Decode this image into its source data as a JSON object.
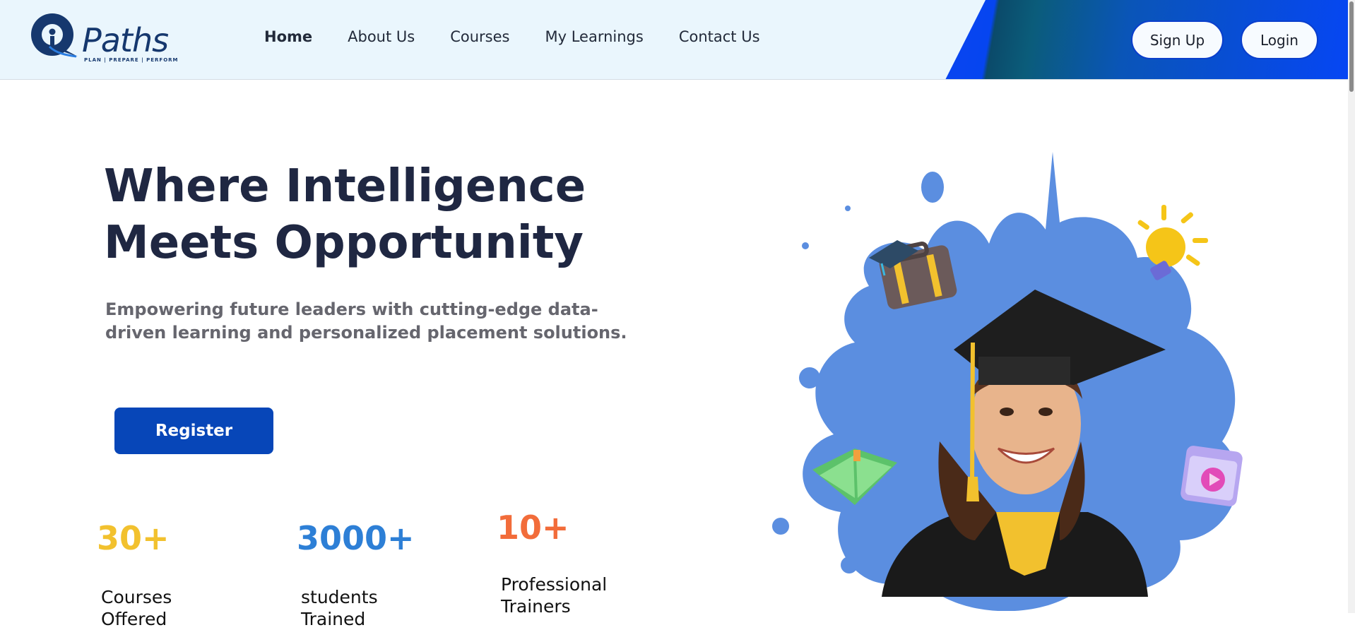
{
  "brand": {
    "name": "Paths",
    "tagline": "PLAN | PREPARE | PERFORM",
    "color": "#16386e"
  },
  "nav": {
    "items": [
      {
        "label": "Home",
        "active": true
      },
      {
        "label": "About Us",
        "active": false
      },
      {
        "label": "Courses",
        "active": false
      },
      {
        "label": "My Learnings",
        "active": false
      },
      {
        "label": "Contact Us",
        "active": false
      }
    ]
  },
  "auth": {
    "signup_label": "Sign Up",
    "login_label": "Login"
  },
  "hero": {
    "title_line1": "Where Intelligence",
    "title_line2": "Meets Opportunity",
    "subtitle": "Empowering future leaders with cutting-edge data-driven learning and personalized placement solutions.",
    "register_label": "Register",
    "illustration_icons": [
      "graduation-briefcase-icon",
      "lightbulb-icon",
      "open-book-icon",
      "video-play-icon"
    ]
  },
  "stats": [
    {
      "value": "30+",
      "label": "Courses Offered",
      "color": "#f2c12e"
    },
    {
      "value": "3000+",
      "label": "students Trained",
      "color": "#2d7fd6"
    },
    {
      "value": "10+",
      "label": "Professional Trainers",
      "color": "#f26c3a"
    }
  ],
  "colors": {
    "header_bg": "#eaf6fd",
    "accent_blue": "#0646f4",
    "button_blue": "#0746b8",
    "heading": "#1f2742"
  }
}
